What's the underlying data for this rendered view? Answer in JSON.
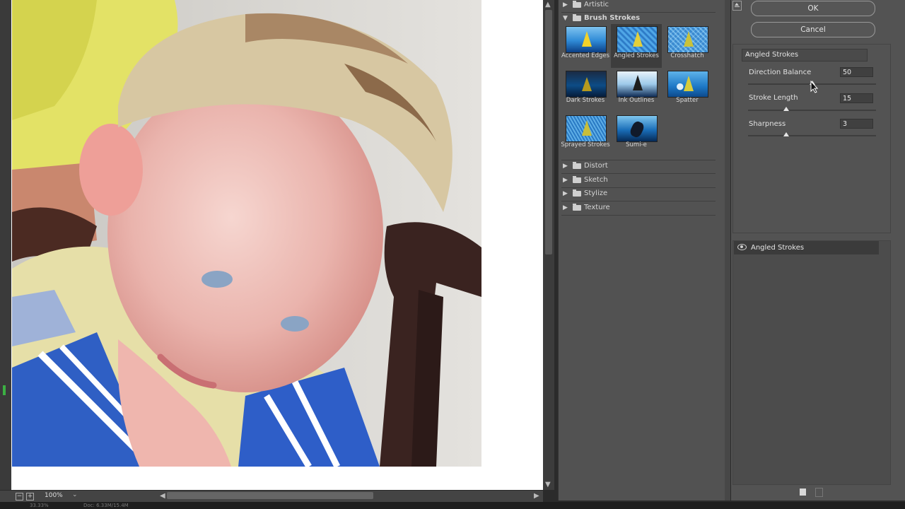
{
  "preview": {
    "zoom": "100%",
    "status_text": "33.33%",
    "doc_info": "Doc: 6.33M/15.4M"
  },
  "gallery": {
    "categories_top": [
      {
        "label": "Artistic",
        "expanded": false
      },
      {
        "label": "Brush Strokes",
        "expanded": true
      }
    ],
    "brush_strokes": [
      {
        "label": "Accented Edges",
        "selected": false
      },
      {
        "label": "Angled Strokes",
        "selected": true
      },
      {
        "label": "Crosshatch",
        "selected": false
      },
      {
        "label": "Dark Strokes",
        "selected": false
      },
      {
        "label": "Ink Outlines",
        "selected": false
      },
      {
        "label": "Spatter",
        "selected": false
      },
      {
        "label": "Sprayed Strokes",
        "selected": false
      },
      {
        "label": "Sumi-e",
        "selected": false
      }
    ],
    "categories_bottom": [
      {
        "label": "Distort"
      },
      {
        "label": "Sketch"
      },
      {
        "label": "Stylize"
      },
      {
        "label": "Texture"
      }
    ]
  },
  "actions": {
    "ok_label": "OK",
    "cancel_label": "Cancel"
  },
  "settings": {
    "selected_filter": "Angled Strokes",
    "params": [
      {
        "label": "Direction Balance",
        "value": "50",
        "fraction": 0.5
      },
      {
        "label": "Stroke Length",
        "value": "15",
        "fraction": 0.3
      },
      {
        "label": "Sharpness",
        "value": "3",
        "fraction": 0.3
      }
    ]
  },
  "layers": {
    "items": [
      {
        "label": "Angled Strokes",
        "visible": true
      }
    ]
  },
  "colors": {
    "panel_bg": "#535353",
    "gallery_bg": "#525252",
    "preview_bg": "#ffffff"
  }
}
